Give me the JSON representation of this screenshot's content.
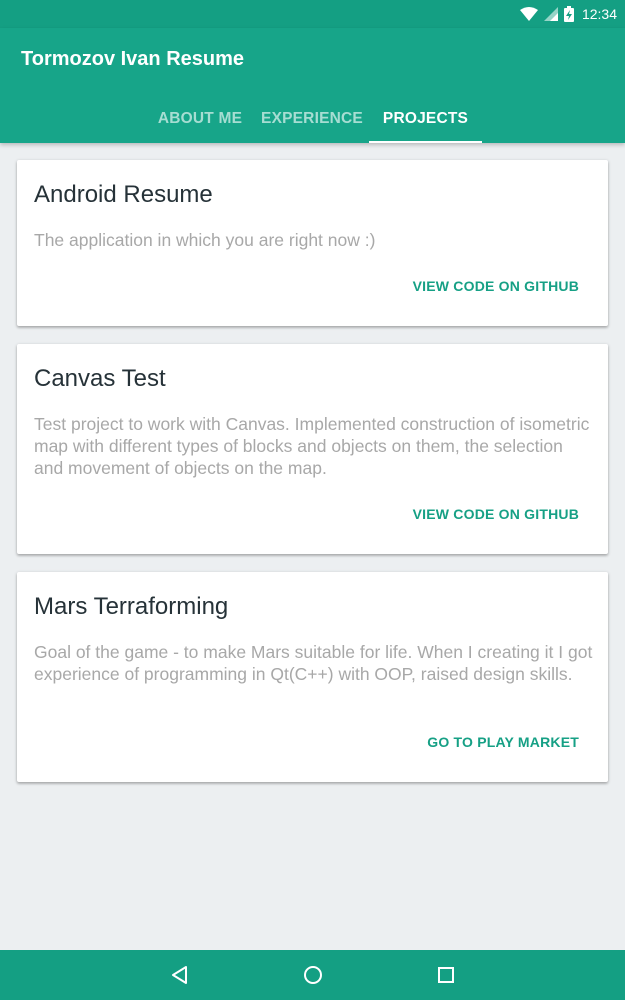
{
  "status_bar": {
    "time": "12:34",
    "icons": [
      "wifi-icon",
      "signal-icon",
      "battery-charging-icon"
    ]
  },
  "app_bar": {
    "title": "Tormozov Ivan Resume",
    "tabs": [
      {
        "label": "ABOUT ME",
        "active": false
      },
      {
        "label": "EXPERIENCE",
        "active": false
      },
      {
        "label": "PROJECTS",
        "active": true
      }
    ]
  },
  "projects": [
    {
      "title": "Android Resume",
      "description": "The application in which you are right now :)",
      "action": "VIEW CODE ON GITHUB"
    },
    {
      "title": "Canvas Test",
      "description": "Test project to work with Canvas. Implemented construction of isometric map with different types of blocks and objects on them, the selection and movement of objects on the map.",
      "action": "VIEW CODE ON GITHUB"
    },
    {
      "title": "Mars Terraforming",
      "description": "Goal of the game - to make Mars suitable for life. When I creating it I got experience of programming in Qt(C++) with OOP, raised design skills.",
      "action": "GO TO PLAY MARKET"
    }
  ],
  "nav_bar": {
    "icons": [
      "back-icon",
      "home-icon",
      "recents-icon"
    ]
  },
  "colors": {
    "primary": "#17A589",
    "primary_dark": "#149F83",
    "accent": "#16A085",
    "background": "#ECEFF1",
    "card_title": "#263238",
    "card_text": "#A8A8A8"
  }
}
